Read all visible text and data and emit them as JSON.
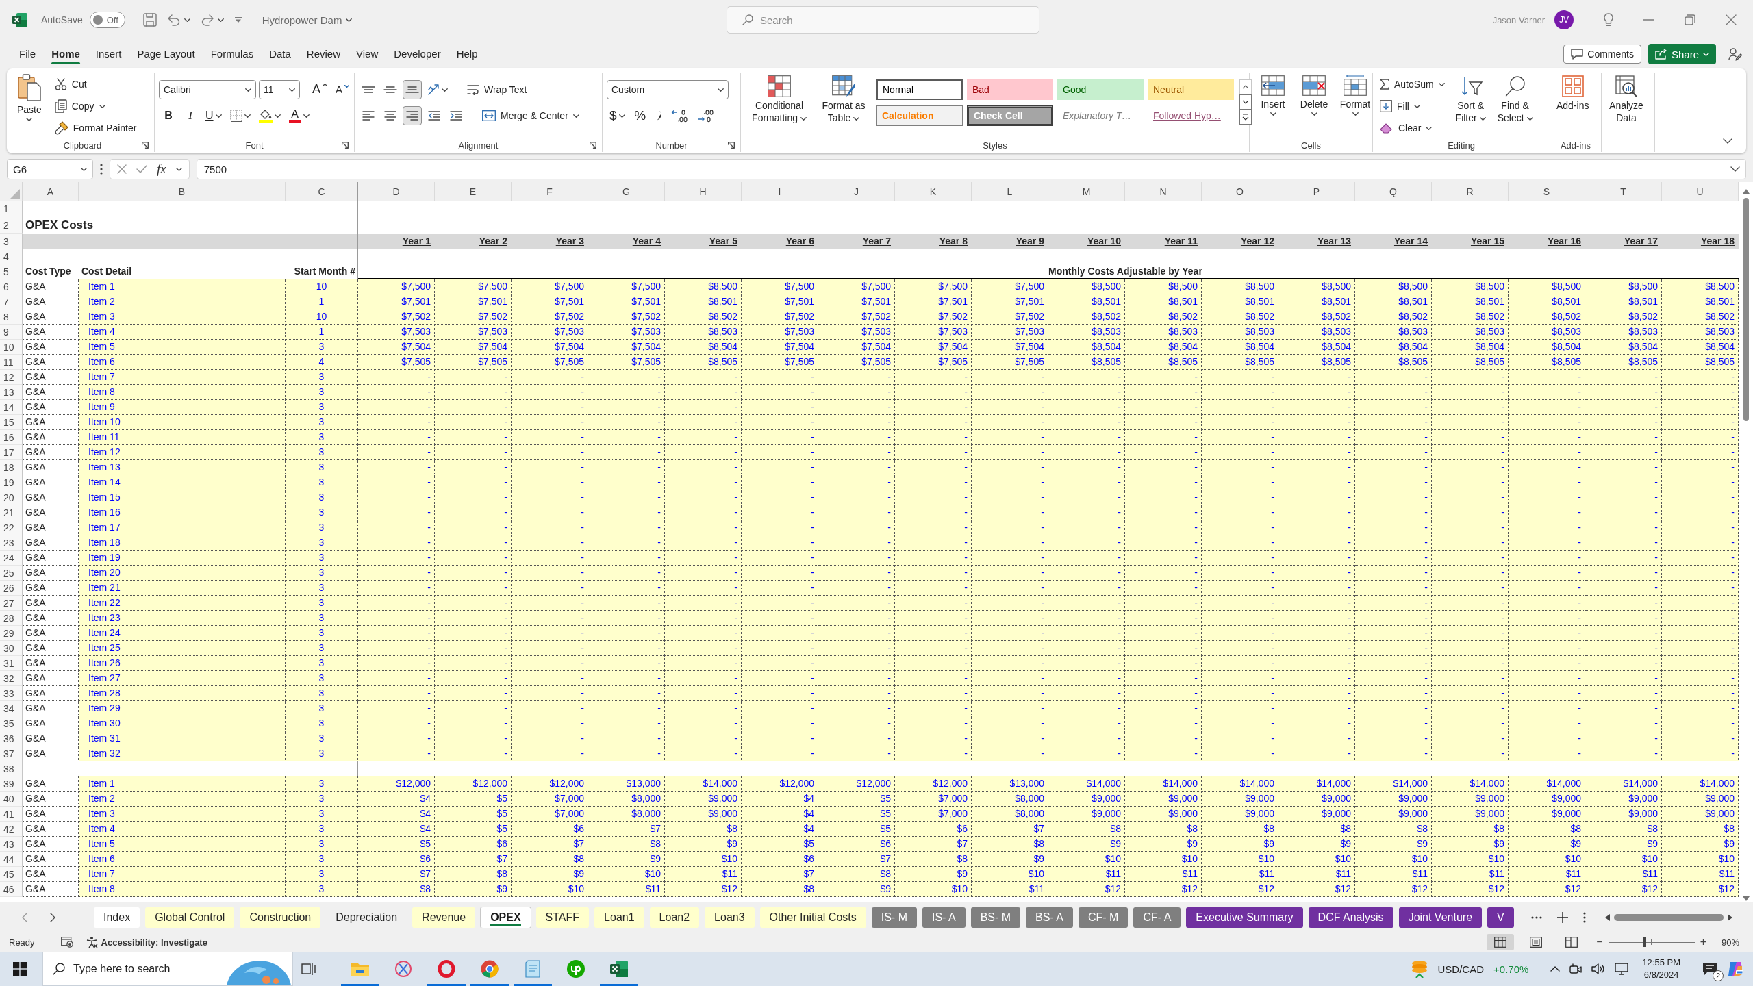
{
  "title_bar": {
    "autosave": {
      "label": "AutoSave",
      "state": "Off",
      "on": false
    },
    "document": "Hydropower Dam",
    "search": {
      "placeholder": "Search"
    },
    "user": {
      "name": "Jason Varner",
      "initials": "JV"
    }
  },
  "menu": {
    "tabs": [
      {
        "label": "File",
        "selected": false
      },
      {
        "label": "Home",
        "selected": true
      },
      {
        "label": "Insert",
        "selected": false
      },
      {
        "label": "Page Layout",
        "selected": false
      },
      {
        "label": "Formulas",
        "selected": false
      },
      {
        "label": "Data",
        "selected": false
      },
      {
        "label": "Review",
        "selected": false
      },
      {
        "label": "View",
        "selected": false
      },
      {
        "label": "Developer",
        "selected": false
      },
      {
        "label": "Help",
        "selected": false
      }
    ],
    "comments": "Comments",
    "share": "Share"
  },
  "ribbon": {
    "clipboard": {
      "label": "Clipboard",
      "paste": "Paste",
      "cut": "Cut",
      "copy": "Copy",
      "format_painter": "Format Painter"
    },
    "font": {
      "label": "Font",
      "name": "Calibri",
      "size": "11",
      "grow": "A",
      "shrink": "A",
      "bold": "B",
      "italic": "I",
      "underline": "U",
      "font_color": "A"
    },
    "alignment": {
      "label": "Alignment",
      "vertical": [
        {
          "selected": false
        },
        {
          "selected": false
        },
        {
          "selected": true
        }
      ],
      "horizontal": [
        {
          "selected": false
        },
        {
          "selected": false
        },
        {
          "selected": true
        }
      ],
      "wrap_text": "Wrap Text",
      "merge_center": "Merge & Center"
    },
    "number": {
      "label": "Number",
      "format": "Custom",
      "currency": "$",
      "percent": "%"
    },
    "styles": {
      "label": "Styles",
      "conditional_formatting": "Conditional Formatting",
      "format_as_table": "Format as Table",
      "cell_styles": [
        {
          "label": "Normal",
          "kind": "normal",
          "selected": true
        },
        {
          "label": "Bad",
          "kind": "bad",
          "selected": false
        },
        {
          "label": "Good",
          "kind": "good",
          "selected": false
        },
        {
          "label": "Neutral",
          "kind": "neutral",
          "selected": false
        },
        {
          "label": "Calculation",
          "kind": "calculation",
          "selected": false
        },
        {
          "label": "Check Cell",
          "kind": "check",
          "selected": false
        },
        {
          "label": "Explanatory T…",
          "kind": "explanatory",
          "selected": false
        },
        {
          "label": "Followed Hyp…",
          "kind": "followed_hyperlink",
          "selected": false
        }
      ]
    },
    "cells": {
      "label": "Cells",
      "insert": "Insert",
      "delete": "Delete",
      "format": "Format"
    },
    "editing": {
      "label": "Editing",
      "autosum": "AutoSum",
      "fill": "Fill",
      "clear": "Clear",
      "sort_filter": "Sort & Filter",
      "find_select": "Find & Select"
    },
    "addins": {
      "label": "Add-ins",
      "addins": "Add-ins",
      "analyze_data": "Analyze Data"
    }
  },
  "formula_bar": {
    "name_box": "G6",
    "function": "fx",
    "formula": "7500"
  },
  "sheet": {
    "columns": [
      "A",
      "B",
      "C",
      "D",
      "E",
      "F",
      "G",
      "H",
      "I",
      "J",
      "K",
      "L",
      "M",
      "N",
      "O",
      "P",
      "Q",
      "R",
      "S",
      "T",
      "U"
    ],
    "rows": [
      {
        "number": "1",
        "kind": "blank"
      },
      {
        "number": "2",
        "kind": "title",
        "text": "OPEX Costs"
      },
      {
        "number": "3",
        "kind": "years",
        "cells": [
          "Year 1",
          "Year 2",
          "Year 3",
          "Year 4",
          "Year 5",
          "Year 6",
          "Year 7",
          "Year 8",
          "Year 9",
          "Year 10",
          "Year 11",
          "Year 12",
          "Year 13",
          "Year 14",
          "Year 15",
          "Year 16",
          "Year 17",
          "Year 18"
        ]
      },
      {
        "number": "4",
        "kind": "blank"
      },
      {
        "number": "5",
        "kind": "labels",
        "cost_type": "Cost Type",
        "cost_detail": "Cost Detail",
        "start_month": "Start Month #",
        "note": "Monthly Costs Adjustable by Year"
      },
      {
        "number": "6",
        "kind": "data",
        "cost_type": "G&A",
        "item": "Item 1",
        "start_month": "10",
        "values": [
          "$7,500",
          "$7,500",
          "$7,500",
          "$7,500",
          "$8,500",
          "$7,500",
          "$7,500",
          "$7,500",
          "$7,500",
          "$8,500",
          "$8,500",
          "$8,500",
          "$8,500",
          "$8,500",
          "$8,500",
          "$8,500",
          "$8,500",
          "$8,500"
        ]
      },
      {
        "number": "7",
        "kind": "data",
        "cost_type": "G&A",
        "item": "Item 2",
        "start_month": "1",
        "values": [
          "$7,501",
          "$7,501",
          "$7,501",
          "$7,501",
          "$8,501",
          "$7,501",
          "$7,501",
          "$7,501",
          "$7,501",
          "$8,501",
          "$8,501",
          "$8,501",
          "$8,501",
          "$8,501",
          "$8,501",
          "$8,501",
          "$8,501",
          "$8,501"
        ]
      },
      {
        "number": "8",
        "kind": "data",
        "cost_type": "G&A",
        "item": "Item 3",
        "start_month": "10",
        "values": [
          "$7,502",
          "$7,502",
          "$7,502",
          "$7,502",
          "$8,502",
          "$7,502",
          "$7,502",
          "$7,502",
          "$7,502",
          "$8,502",
          "$8,502",
          "$8,502",
          "$8,502",
          "$8,502",
          "$8,502",
          "$8,502",
          "$8,502",
          "$8,502"
        ]
      },
      {
        "number": "9",
        "kind": "data",
        "cost_type": "G&A",
        "item": "Item 4",
        "start_month": "1",
        "values": [
          "$7,503",
          "$7,503",
          "$7,503",
          "$7,503",
          "$8,503",
          "$7,503",
          "$7,503",
          "$7,503",
          "$7,503",
          "$8,503",
          "$8,503",
          "$8,503",
          "$8,503",
          "$8,503",
          "$8,503",
          "$8,503",
          "$8,503",
          "$8,503"
        ]
      },
      {
        "number": "10",
        "kind": "data",
        "cost_type": "G&A",
        "item": "Item 5",
        "start_month": "3",
        "values": [
          "$7,504",
          "$7,504",
          "$7,504",
          "$7,504",
          "$8,504",
          "$7,504",
          "$7,504",
          "$7,504",
          "$7,504",
          "$8,504",
          "$8,504",
          "$8,504",
          "$8,504",
          "$8,504",
          "$8,504",
          "$8,504",
          "$8,504",
          "$8,504"
        ]
      },
      {
        "number": "11",
        "kind": "data",
        "cost_type": "G&A",
        "item": "Item 6",
        "start_month": "4",
        "values": [
          "$7,505",
          "$7,505",
          "$7,505",
          "$7,505",
          "$8,505",
          "$7,505",
          "$7,505",
          "$7,505",
          "$7,505",
          "$8,505",
          "$8,505",
          "$8,505",
          "$8,505",
          "$8,505",
          "$8,505",
          "$8,505",
          "$8,505",
          "$8,505"
        ]
      },
      {
        "number": "12",
        "kind": "data",
        "cost_type": "G&A",
        "item": "Item 7",
        "start_month": "3",
        "values": [
          "-",
          "-",
          "-",
          "-",
          "-",
          "-",
          "-",
          "-",
          "-",
          "-",
          "-",
          "-",
          "-",
          "-",
          "-",
          "-",
          "-",
          "-"
        ]
      },
      {
        "number": "13",
        "kind": "data",
        "cost_type": "G&A",
        "item": "Item 8",
        "start_month": "3",
        "values": [
          "-",
          "-",
          "-",
          "-",
          "-",
          "-",
          "-",
          "-",
          "-",
          "-",
          "-",
          "-",
          "-",
          "-",
          "-",
          "-",
          "-",
          "-"
        ]
      },
      {
        "number": "14",
        "kind": "data",
        "cost_type": "G&A",
        "item": "Item 9",
        "start_month": "3",
        "values": [
          "-",
          "-",
          "-",
          "-",
          "-",
          "-",
          "-",
          "-",
          "-",
          "-",
          "-",
          "-",
          "-",
          "-",
          "-",
          "-",
          "-",
          "-"
        ]
      },
      {
        "number": "15",
        "kind": "data",
        "cost_type": "G&A",
        "item": "Item 10",
        "start_month": "3",
        "values": [
          "-",
          "-",
          "-",
          "-",
          "-",
          "-",
          "-",
          "-",
          "-",
          "-",
          "-",
          "-",
          "-",
          "-",
          "-",
          "-",
          "-",
          "-"
        ]
      },
      {
        "number": "16",
        "kind": "data",
        "cost_type": "G&A",
        "item": "Item 11",
        "start_month": "3",
        "values": [
          "-",
          "-",
          "-",
          "-",
          "-",
          "-",
          "-",
          "-",
          "-",
          "-",
          "-",
          "-",
          "-",
          "-",
          "-",
          "-",
          "-",
          "-"
        ]
      },
      {
        "number": "17",
        "kind": "data",
        "cost_type": "G&A",
        "item": "Item 12",
        "start_month": "3",
        "values": [
          "-",
          "-",
          "-",
          "-",
          "-",
          "-",
          "-",
          "-",
          "-",
          "-",
          "-",
          "-",
          "-",
          "-",
          "-",
          "-",
          "-",
          "-"
        ]
      },
      {
        "number": "18",
        "kind": "data",
        "cost_type": "G&A",
        "item": "Item 13",
        "start_month": "3",
        "values": [
          "-",
          "-",
          "-",
          "-",
          "-",
          "-",
          "-",
          "-",
          "-",
          "-",
          "-",
          "-",
          "-",
          "-",
          "-",
          "-",
          "-",
          "-"
        ]
      },
      {
        "number": "19",
        "kind": "data",
        "cost_type": "G&A",
        "item": "Item 14",
        "start_month": "3",
        "values": [
          "-",
          "-",
          "-",
          "-",
          "-",
          "-",
          "-",
          "-",
          "-",
          "-",
          "-",
          "-",
          "-",
          "-",
          "-",
          "-",
          "-",
          "-"
        ]
      },
      {
        "number": "20",
        "kind": "data",
        "cost_type": "G&A",
        "item": "Item 15",
        "start_month": "3",
        "values": [
          "-",
          "-",
          "-",
          "-",
          "-",
          "-",
          "-",
          "-",
          "-",
          "-",
          "-",
          "-",
          "-",
          "-",
          "-",
          "-",
          "-",
          "-"
        ]
      },
      {
        "number": "21",
        "kind": "data",
        "cost_type": "G&A",
        "item": "Item 16",
        "start_month": "3",
        "values": [
          "-",
          "-",
          "-",
          "-",
          "-",
          "-",
          "-",
          "-",
          "-",
          "-",
          "-",
          "-",
          "-",
          "-",
          "-",
          "-",
          "-",
          "-"
        ]
      },
      {
        "number": "22",
        "kind": "data",
        "cost_type": "G&A",
        "item": "Item 17",
        "start_month": "3",
        "values": [
          "-",
          "-",
          "-",
          "-",
          "-",
          "-",
          "-",
          "-",
          "-",
          "-",
          "-",
          "-",
          "-",
          "-",
          "-",
          "-",
          "-",
          "-"
        ]
      },
      {
        "number": "23",
        "kind": "data",
        "cost_type": "G&A",
        "item": "Item 18",
        "start_month": "3",
        "values": [
          "-",
          "-",
          "-",
          "-",
          "-",
          "-",
          "-",
          "-",
          "-",
          "-",
          "-",
          "-",
          "-",
          "-",
          "-",
          "-",
          "-",
          "-"
        ]
      },
      {
        "number": "24",
        "kind": "data",
        "cost_type": "G&A",
        "item": "Item 19",
        "start_month": "3",
        "values": [
          "-",
          "-",
          "-",
          "-",
          "-",
          "-",
          "-",
          "-",
          "-",
          "-",
          "-",
          "-",
          "-",
          "-",
          "-",
          "-",
          "-",
          "-"
        ]
      },
      {
        "number": "25",
        "kind": "data",
        "cost_type": "G&A",
        "item": "Item 20",
        "start_month": "3",
        "values": [
          "-",
          "-",
          "-",
          "-",
          "-",
          "-",
          "-",
          "-",
          "-",
          "-",
          "-",
          "-",
          "-",
          "-",
          "-",
          "-",
          "-",
          "-"
        ]
      },
      {
        "number": "26",
        "kind": "data",
        "cost_type": "G&A",
        "item": "Item 21",
        "start_month": "3",
        "values": [
          "-",
          "-",
          "-",
          "-",
          "-",
          "-",
          "-",
          "-",
          "-",
          "-",
          "-",
          "-",
          "-",
          "-",
          "-",
          "-",
          "-",
          "-"
        ]
      },
      {
        "number": "27",
        "kind": "data",
        "cost_type": "G&A",
        "item": "Item 22",
        "start_month": "3",
        "values": [
          "-",
          "-",
          "-",
          "-",
          "-",
          "-",
          "-",
          "-",
          "-",
          "-",
          "-",
          "-",
          "-",
          "-",
          "-",
          "-",
          "-",
          "-"
        ]
      },
      {
        "number": "28",
        "kind": "data",
        "cost_type": "G&A",
        "item": "Item 23",
        "start_month": "3",
        "values": [
          "-",
          "-",
          "-",
          "-",
          "-",
          "-",
          "-",
          "-",
          "-",
          "-",
          "-",
          "-",
          "-",
          "-",
          "-",
          "-",
          "-",
          "-"
        ]
      },
      {
        "number": "29",
        "kind": "data",
        "cost_type": "G&A",
        "item": "Item 24",
        "start_month": "3",
        "values": [
          "-",
          "-",
          "-",
          "-",
          "-",
          "-",
          "-",
          "-",
          "-",
          "-",
          "-",
          "-",
          "-",
          "-",
          "-",
          "-",
          "-",
          "-"
        ]
      },
      {
        "number": "30",
        "kind": "data",
        "cost_type": "G&A",
        "item": "Item 25",
        "start_month": "3",
        "values": [
          "-",
          "-",
          "-",
          "-",
          "-",
          "-",
          "-",
          "-",
          "-",
          "-",
          "-",
          "-",
          "-",
          "-",
          "-",
          "-",
          "-",
          "-"
        ]
      },
      {
        "number": "31",
        "kind": "data",
        "cost_type": "G&A",
        "item": "Item 26",
        "start_month": "3",
        "values": [
          "-",
          "-",
          "-",
          "-",
          "-",
          "-",
          "-",
          "-",
          "-",
          "-",
          "-",
          "-",
          "-",
          "-",
          "-",
          "-",
          "-",
          "-"
        ]
      },
      {
        "number": "32",
        "kind": "data",
        "cost_type": "G&A",
        "item": "Item 27",
        "start_month": "3",
        "values": [
          "-",
          "-",
          "-",
          "-",
          "-",
          "-",
          "-",
          "-",
          "-",
          "-",
          "-",
          "-",
          "-",
          "-",
          "-",
          "-",
          "-",
          "-"
        ]
      },
      {
        "number": "33",
        "kind": "data",
        "cost_type": "G&A",
        "item": "Item 28",
        "start_month": "3",
        "values": [
          "-",
          "-",
          "-",
          "-",
          "-",
          "-",
          "-",
          "-",
          "-",
          "-",
          "-",
          "-",
          "-",
          "-",
          "-",
          "-",
          "-",
          "-"
        ]
      },
      {
        "number": "34",
        "kind": "data",
        "cost_type": "G&A",
        "item": "Item 29",
        "start_month": "3",
        "values": [
          "-",
          "-",
          "-",
          "-",
          "-",
          "-",
          "-",
          "-",
          "-",
          "-",
          "-",
          "-",
          "-",
          "-",
          "-",
          "-",
          "-",
          "-"
        ]
      },
      {
        "number": "35",
        "kind": "data",
        "cost_type": "G&A",
        "item": "Item 30",
        "start_month": "3",
        "values": [
          "-",
          "-",
          "-",
          "-",
          "-",
          "-",
          "-",
          "-",
          "-",
          "-",
          "-",
          "-",
          "-",
          "-",
          "-",
          "-",
          "-",
          "-"
        ]
      },
      {
        "number": "36",
        "kind": "data",
        "cost_type": "G&A",
        "item": "Item 31",
        "start_month": "3",
        "values": [
          "-",
          "-",
          "-",
          "-",
          "-",
          "-",
          "-",
          "-",
          "-",
          "-",
          "-",
          "-",
          "-",
          "-",
          "-",
          "-",
          "-",
          "-"
        ]
      },
      {
        "number": "37",
        "kind": "data",
        "cost_type": "G&A",
        "item": "Item 32",
        "start_month": "3",
        "values": [
          "-",
          "-",
          "-",
          "-",
          "-",
          "-",
          "-",
          "-",
          "-",
          "-",
          "-",
          "-",
          "-",
          "-",
          "-",
          "-",
          "-",
          "-"
        ]
      },
      {
        "number": "38",
        "kind": "blank"
      },
      {
        "number": "39",
        "kind": "data",
        "cost_type": "G&A",
        "item": "Item 1",
        "start_month": "3",
        "values": [
          "$12,000",
          "$12,000",
          "$12,000",
          "$13,000",
          "$14,000",
          "$12,000",
          "$12,000",
          "$12,000",
          "$13,000",
          "$14,000",
          "$14,000",
          "$14,000",
          "$14,000",
          "$14,000",
          "$14,000",
          "$14,000",
          "$14,000",
          "$14,000"
        ]
      },
      {
        "number": "40",
        "kind": "data",
        "cost_type": "G&A",
        "item": "Item 2",
        "start_month": "3",
        "values": [
          "$4",
          "$5",
          "$7,000",
          "$8,000",
          "$9,000",
          "$4",
          "$5",
          "$7,000",
          "$8,000",
          "$9,000",
          "$9,000",
          "$9,000",
          "$9,000",
          "$9,000",
          "$9,000",
          "$9,000",
          "$9,000",
          "$9,000"
        ]
      },
      {
        "number": "41",
        "kind": "data",
        "cost_type": "G&A",
        "item": "Item 3",
        "start_month": "3",
        "values": [
          "$4",
          "$5",
          "$7,000",
          "$8,000",
          "$9,000",
          "$4",
          "$5",
          "$7,000",
          "$8,000",
          "$9,000",
          "$9,000",
          "$9,000",
          "$9,000",
          "$9,000",
          "$9,000",
          "$9,000",
          "$9,000",
          "$9,000"
        ]
      },
      {
        "number": "42",
        "kind": "data",
        "cost_type": "G&A",
        "item": "Item 4",
        "start_month": "3",
        "values": [
          "$4",
          "$5",
          "$6",
          "$7",
          "$8",
          "$4",
          "$5",
          "$6",
          "$7",
          "$8",
          "$8",
          "$8",
          "$8",
          "$8",
          "$8",
          "$8",
          "$8",
          "$8"
        ]
      },
      {
        "number": "43",
        "kind": "data",
        "cost_type": "G&A",
        "item": "Item 5",
        "start_month": "3",
        "values": [
          "$5",
          "$6",
          "$7",
          "$8",
          "$9",
          "$5",
          "$6",
          "$7",
          "$8",
          "$9",
          "$9",
          "$9",
          "$9",
          "$9",
          "$9",
          "$9",
          "$9",
          "$9"
        ]
      },
      {
        "number": "44",
        "kind": "data",
        "cost_type": "G&A",
        "item": "Item 6",
        "start_month": "3",
        "values": [
          "$6",
          "$7",
          "$8",
          "$9",
          "$10",
          "$6",
          "$7",
          "$8",
          "$9",
          "$10",
          "$10",
          "$10",
          "$10",
          "$10",
          "$10",
          "$10",
          "$10",
          "$10"
        ]
      },
      {
        "number": "45",
        "kind": "data",
        "cost_type": "G&A",
        "item": "Item 7",
        "start_month": "3",
        "values": [
          "$7",
          "$8",
          "$9",
          "$10",
          "$11",
          "$7",
          "$8",
          "$9",
          "$10",
          "$11",
          "$11",
          "$11",
          "$11",
          "$11",
          "$11",
          "$11",
          "$11",
          "$11"
        ]
      },
      {
        "number": "46",
        "kind": "data",
        "cost_type": "G&A",
        "item": "Item 8",
        "start_month": "3",
        "values": [
          "$8",
          "$9",
          "$10",
          "$11",
          "$12",
          "$8",
          "$9",
          "$10",
          "$11",
          "$12",
          "$12",
          "$12",
          "$12",
          "$12",
          "$12",
          "$12",
          "$12",
          "$12"
        ]
      }
    ]
  },
  "sheet_tabs": [
    {
      "label": "Index",
      "selected": false,
      "color": "#ffffff"
    },
    {
      "label": "Global Control",
      "selected": false,
      "color": "#ffffcc"
    },
    {
      "label": "Construction",
      "selected": false,
      "color": "#ffffcc"
    },
    {
      "label": "Depreciation",
      "selected": false
    },
    {
      "label": "Revenue",
      "selected": false,
      "color": "#ffffcc"
    },
    {
      "label": "OPEX",
      "selected": true
    },
    {
      "label": "STAFF",
      "selected": false,
      "color": "#ffffcc"
    },
    {
      "label": "Loan1",
      "selected": false,
      "color": "#ffffcc"
    },
    {
      "label": "Loan2",
      "selected": false,
      "color": "#ffffcc"
    },
    {
      "label": "Loan3",
      "selected": false,
      "color": "#ffffcc"
    },
    {
      "label": "Other Initial Costs",
      "selected": false,
      "color": "#ffffcc"
    },
    {
      "label": "IS- M",
      "selected": false,
      "color": "#7f7f7f"
    },
    {
      "label": "IS- A",
      "selected": false,
      "color": "#7f7f7f"
    },
    {
      "label": "BS- M",
      "selected": false,
      "color": "#7f7f7f"
    },
    {
      "label": "BS- A",
      "selected": false,
      "color": "#7f7f7f"
    },
    {
      "label": "CF- M",
      "selected": false,
      "color": "#7f7f7f"
    },
    {
      "label": "CF- A",
      "selected": false,
      "color": "#7f7f7f"
    },
    {
      "label": "Executive Summary",
      "selected": false,
      "color": "#7030a0"
    },
    {
      "label": "DCF Analysis",
      "selected": false,
      "color": "#7030a0"
    },
    {
      "label": "Joint Venture",
      "selected": false,
      "color": "#7030a0"
    },
    {
      "label": "V",
      "selected": false,
      "color": "#7030a0"
    }
  ],
  "status_bar": {
    "mode": "Ready",
    "accessibility": "Accessibility: Investigate",
    "views": [
      {
        "selected": true
      },
      {
        "selected": false
      },
      {
        "selected": false
      }
    ],
    "zoom": {
      "minus": "−",
      "plus": "+",
      "level": 0.42,
      "reading": "90%"
    }
  },
  "taskbar": {
    "search": {
      "placeholder": "Type here to search"
    },
    "apps": [
      {
        "running": true
      },
      {
        "running": false
      },
      {
        "running": true
      },
      {
        "running": true
      },
      {
        "running": true
      },
      {
        "running": false
      },
      {
        "running": true
      }
    ],
    "ticker": {
      "symbol": "USD/CAD",
      "change": "+0.70%"
    },
    "time": "12:55 PM",
    "date": "6/8/2024",
    "notifications": "2"
  }
}
